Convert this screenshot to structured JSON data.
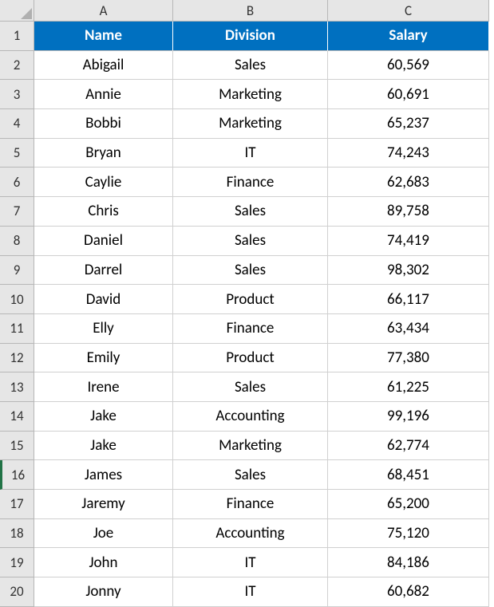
{
  "columns": [
    "A",
    "B",
    "C"
  ],
  "headers": {
    "name": "Name",
    "division": "Division",
    "salary": "Salary"
  },
  "rowNumbers": [
    "1",
    "2",
    "3",
    "4",
    "5",
    "6",
    "7",
    "8",
    "9",
    "10",
    "11",
    "12",
    "13",
    "14",
    "15",
    "16",
    "17",
    "18",
    "19",
    "20"
  ],
  "selectedRow": 16,
  "rows": [
    {
      "name": "Abigail",
      "division": "Sales",
      "salary": "60,569"
    },
    {
      "name": "Annie",
      "division": "Marketing",
      "salary": "60,691"
    },
    {
      "name": "Bobbi",
      "division": "Marketing",
      "salary": "65,237"
    },
    {
      "name": "Bryan",
      "division": "IT",
      "salary": "74,243"
    },
    {
      "name": "Caylie",
      "division": "Finance",
      "salary": "62,683"
    },
    {
      "name": "Chris",
      "division": "Sales",
      "salary": "89,758"
    },
    {
      "name": "Daniel",
      "division": "Sales",
      "salary": "74,419"
    },
    {
      "name": "Darrel",
      "division": "Sales",
      "salary": "98,302"
    },
    {
      "name": "David",
      "division": "Product",
      "salary": "66,117"
    },
    {
      "name": "Elly",
      "division": "Finance",
      "salary": "63,434"
    },
    {
      "name": "Emily",
      "division": "Product",
      "salary": "77,380"
    },
    {
      "name": "Irene",
      "division": "Sales",
      "salary": "61,225"
    },
    {
      "name": "Jake",
      "division": "Accounting",
      "salary": "99,196"
    },
    {
      "name": "Jake",
      "division": "Marketing",
      "salary": "62,774"
    },
    {
      "name": "James",
      "division": "Sales",
      "salary": "68,451"
    },
    {
      "name": "Jaremy",
      "division": "Finance",
      "salary": "65,200"
    },
    {
      "name": "Joe",
      "division": "Accounting",
      "salary": "75,120"
    },
    {
      "name": "John",
      "division": "IT",
      "salary": "84,186"
    },
    {
      "name": "Jonny",
      "division": "IT",
      "salary": "60,682"
    }
  ]
}
